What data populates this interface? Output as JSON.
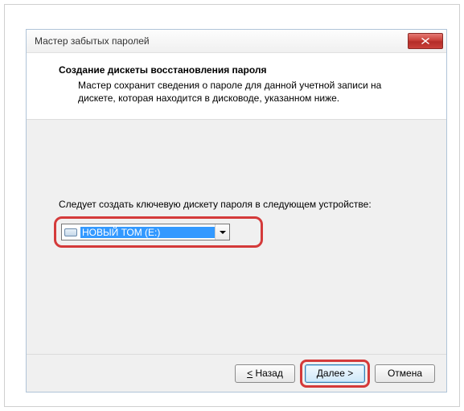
{
  "window": {
    "title": "Мастер забытых паролей"
  },
  "header": {
    "title": "Создание дискеты восстановления пароля",
    "subtitle": "Мастер сохранит сведения о пароле для данной учетной записи на дискете, которая находится в дисководе, указанном ниже."
  },
  "body": {
    "instruction": "Следует создать ключевую дискету пароля в следующем устройстве:",
    "drive": {
      "selected": "НОВЫЙ ТОМ (E:)"
    }
  },
  "buttons": {
    "back": "< Назад",
    "next": "Далее >",
    "cancel": "Отмена"
  }
}
